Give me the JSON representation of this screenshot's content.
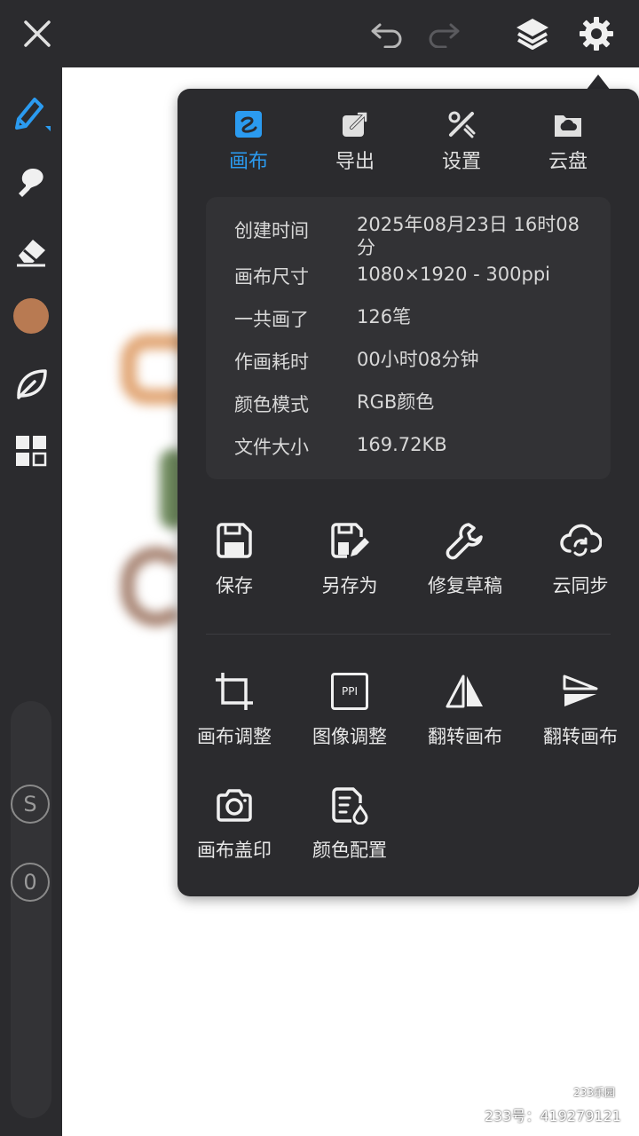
{
  "tabs": [
    {
      "label": "画布",
      "icon": "canvas-icon",
      "active": true
    },
    {
      "label": "导出",
      "icon": "export-icon",
      "active": false
    },
    {
      "label": "设置",
      "icon": "settings-tools-icon",
      "active": false
    },
    {
      "label": "云盘",
      "icon": "cloud-drive-icon",
      "active": false
    }
  ],
  "info": [
    {
      "key": "创建时间",
      "value": "2025年08月23日 16时08分"
    },
    {
      "key": "画布尺寸",
      "value": "1080×1920 - 300ppi"
    },
    {
      "key": "一共画了",
      "value": "126笔"
    },
    {
      "key": "作画耗时",
      "value": "00小时08分钟"
    },
    {
      "key": "颜色模式",
      "value": "RGB颜色"
    },
    {
      "key": "文件大小",
      "value": "169.72KB"
    }
  ],
  "actions_row1": [
    {
      "label": "保存",
      "icon": "save-icon"
    },
    {
      "label": "另存为",
      "icon": "save-as-icon"
    },
    {
      "label": "修复草稿",
      "icon": "wrench-icon"
    },
    {
      "label": "云同步",
      "icon": "cloud-sync-icon"
    }
  ],
  "actions_row2": [
    {
      "label": "画布调整",
      "icon": "crop-icon"
    },
    {
      "label": "图像调整",
      "icon": "ppi-icon",
      "badge": "PPI"
    },
    {
      "label": "翻转画布",
      "icon": "flip-horizontal-icon"
    },
    {
      "label": "翻转画布",
      "icon": "flip-vertical-icon"
    }
  ],
  "actions_row3": [
    {
      "label": "画布盖印",
      "icon": "camera-icon"
    },
    {
      "label": "颜色配置",
      "icon": "color-config-icon"
    }
  ],
  "sidebar": {
    "brush_color": "#b87a52",
    "accent": "#2b9bf0",
    "s_button": "S",
    "zero_button": "0"
  },
  "watermark": {
    "badge": "233乐园",
    "text": "233号：419279121"
  }
}
